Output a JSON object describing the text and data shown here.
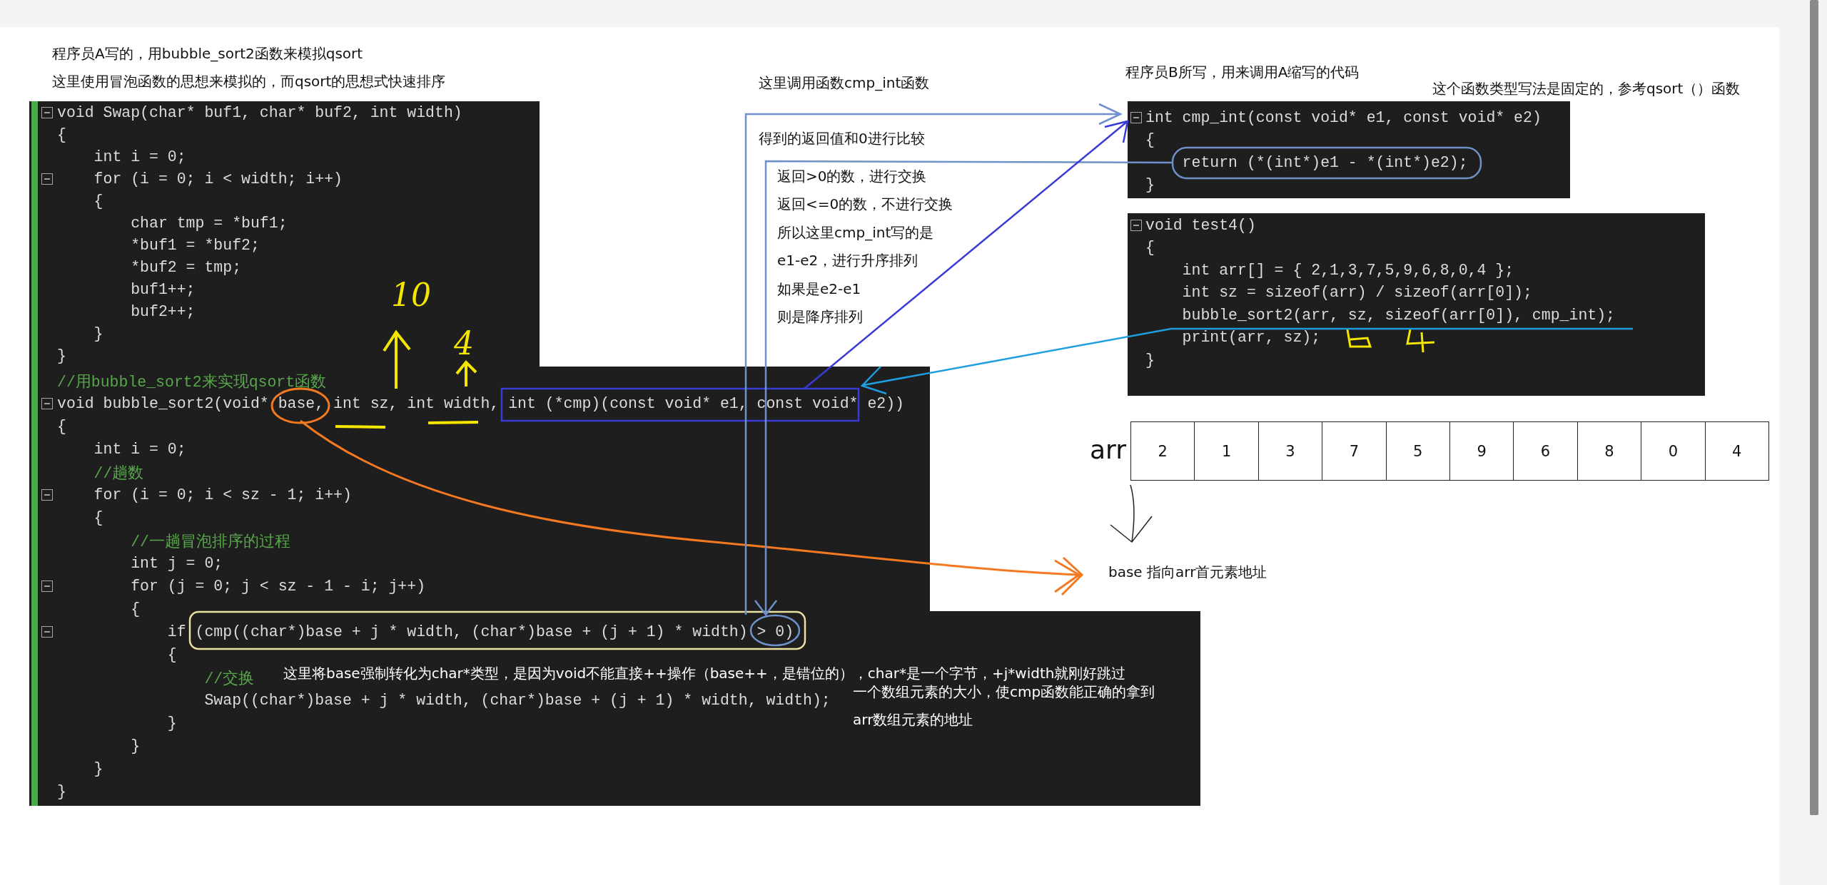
{
  "header_notes": [
    "程序员A写的，用bubble_sort2函数来模拟qsort",
    "这里使用冒泡函数的思想来模拟的，而qsort的思想式快速排序"
  ],
  "swap_code": {
    "lines": [
      {
        "text": "void Swap(char* buf1, char* buf2, int width)",
        "kind": "code",
        "fold": true
      },
      {
        "text": "{",
        "kind": "code",
        "fold": false,
        "children": [
          {
            "text": "int i = 0;",
            "kind": "code",
            "fold": false
          },
          {
            "text": "for (i = 0; i < width; i++)",
            "kind": "code",
            "fold": true
          },
          {
            "text": "{",
            "kind": "code",
            "fold": false,
            "children": [
              {
                "text": "char tmp = *buf1;",
                "kind": "code",
                "fold": false
              },
              {
                "text": "*buf1 = *buf2;",
                "kind": "code",
                "fold": false
              },
              {
                "text": "*buf2 = tmp;",
                "kind": "code",
                "fold": false
              },
              {
                "text": "buf1++;",
                "kind": "code",
                "fold": false
              },
              {
                "text": "buf2++;",
                "kind": "code",
                "fold": false
              }
            ]
          },
          {
            "text": "}",
            "kind": "code",
            "fold": false
          }
        ]
      },
      {
        "text": "}",
        "kind": "code",
        "fold": false
      }
    ]
  },
  "sort_code": {
    "lines": [
      {
        "text": "//用bubble_sort2来实现qsort函数",
        "kind": "comment",
        "fold": false
      },
      {
        "text": "void bubble_sort2(void* base, int sz, int width, int (*cmp)(const void* e1, const void* e2))",
        "kind": "code",
        "fold": true
      },
      {
        "text": "{",
        "kind": "code",
        "fold": false,
        "children": [
          {
            "text": "int i = 0;",
            "kind": "code",
            "fold": false
          },
          {
            "text": "//趟数",
            "kind": "comment",
            "fold": false
          },
          {
            "text": "for (i = 0; i < sz - 1; i++)",
            "kind": "code",
            "fold": true
          },
          {
            "text": "{",
            "kind": "code",
            "fold": false,
            "children": [
              {
                "text": "//一趟冒泡排序的过程",
                "kind": "comment",
                "fold": false
              },
              {
                "text": "int j = 0;",
                "kind": "code",
                "fold": false
              },
              {
                "text": "for (j = 0; j < sz - 1 - i; j++)",
                "kind": "code",
                "fold": true
              },
              {
                "text": "{",
                "kind": "code",
                "fold": false,
                "children": [
                  {
                    "text": "if (cmp((char*)base + j * width, (char*)base + (j + 1) * width) > 0)",
                    "kind": "code",
                    "fold": true
                  },
                  {
                    "text": "{",
                    "kind": "code",
                    "fold": false,
                    "children": [
                      {
                        "text": "//交换",
                        "kind": "comment",
                        "fold": false
                      },
                      {
                        "text": "Swap((char*)base + j * width, (char*)base + (j + 1) * width, width);",
                        "kind": "code",
                        "fold": false
                      }
                    ]
                  },
                  {
                    "text": "}",
                    "kind": "code",
                    "fold": false
                  }
                ]
              },
              {
                "text": "}",
                "kind": "code",
                "fold": false
              }
            ]
          },
          {
            "text": "}",
            "kind": "code",
            "fold": false
          }
        ]
      },
      {
        "text": "}",
        "kind": "code",
        "fold": false
      }
    ]
  },
  "cast_note": [
    "这里将base强制转化为char*类型，是因为void不能直接++操作（base++，是错位的），char*是一个字节，+j*width就刚好跳过",
    "一个数组元素的大小，使cmp函数能正确的拿到",
    "arr数组元素的地址"
  ],
  "call_note": {
    "title": "这里调用函数cmp_int函数",
    "subtitle": "得到的返回值和0进行比较",
    "items": [
      "返回>0的数，进行交换",
      "返回<=0的数，不进行交换",
      "所以这里cmp_int写的是",
      "e1-e2，进行升序排列",
      "如果是e2-e1",
      "则是降序排列"
    ]
  },
  "author_b_note": "程序员B所写，用来调用A缩写的代码",
  "signature_note": "这个函数类型写法是固定的，参考qsort（）函数",
  "cmp_code": {
    "lines": [
      {
        "text": "int cmp_int(const void* e1, const void* e2)",
        "kind": "code",
        "fold": true
      },
      {
        "text": "{",
        "kind": "code",
        "fold": false,
        "children": [
          {
            "text": "return (*(int*)e1 - *(int*)e2);",
            "kind": "code",
            "fold": false
          }
        ]
      },
      {
        "text": "}",
        "kind": "code",
        "fold": false
      }
    ]
  },
  "test_code": {
    "lines": [
      {
        "text": "void test4()",
        "kind": "code",
        "fold": true
      },
      {
        "text": "{",
        "kind": "code",
        "fold": false,
        "children": [
          {
            "text": "int arr[] = { 2,1,3,7,5,9,6,8,0,4 };",
            "kind": "code",
            "fold": false
          },
          {
            "text": "int sz = sizeof(arr) / sizeof(arr[0]);",
            "kind": "code",
            "fold": false
          },
          {
            "text": "bubble_sort2(arr, sz, sizeof(arr[0]), cmp_int);",
            "kind": "code",
            "fold": false
          },
          {
            "text": "print(arr, sz);",
            "kind": "code",
            "fold": false
          }
        ]
      },
      {
        "text": "}",
        "kind": "code",
        "fold": false
      }
    ]
  },
  "array": {
    "label": "arr",
    "cells": [
      "2",
      "1",
      "3",
      "7",
      "5",
      "9",
      "6",
      "8",
      "0",
      "4"
    ]
  },
  "base_note": "base 指向arr首元素地址",
  "handwritten": [
    "10",
    "4"
  ]
}
